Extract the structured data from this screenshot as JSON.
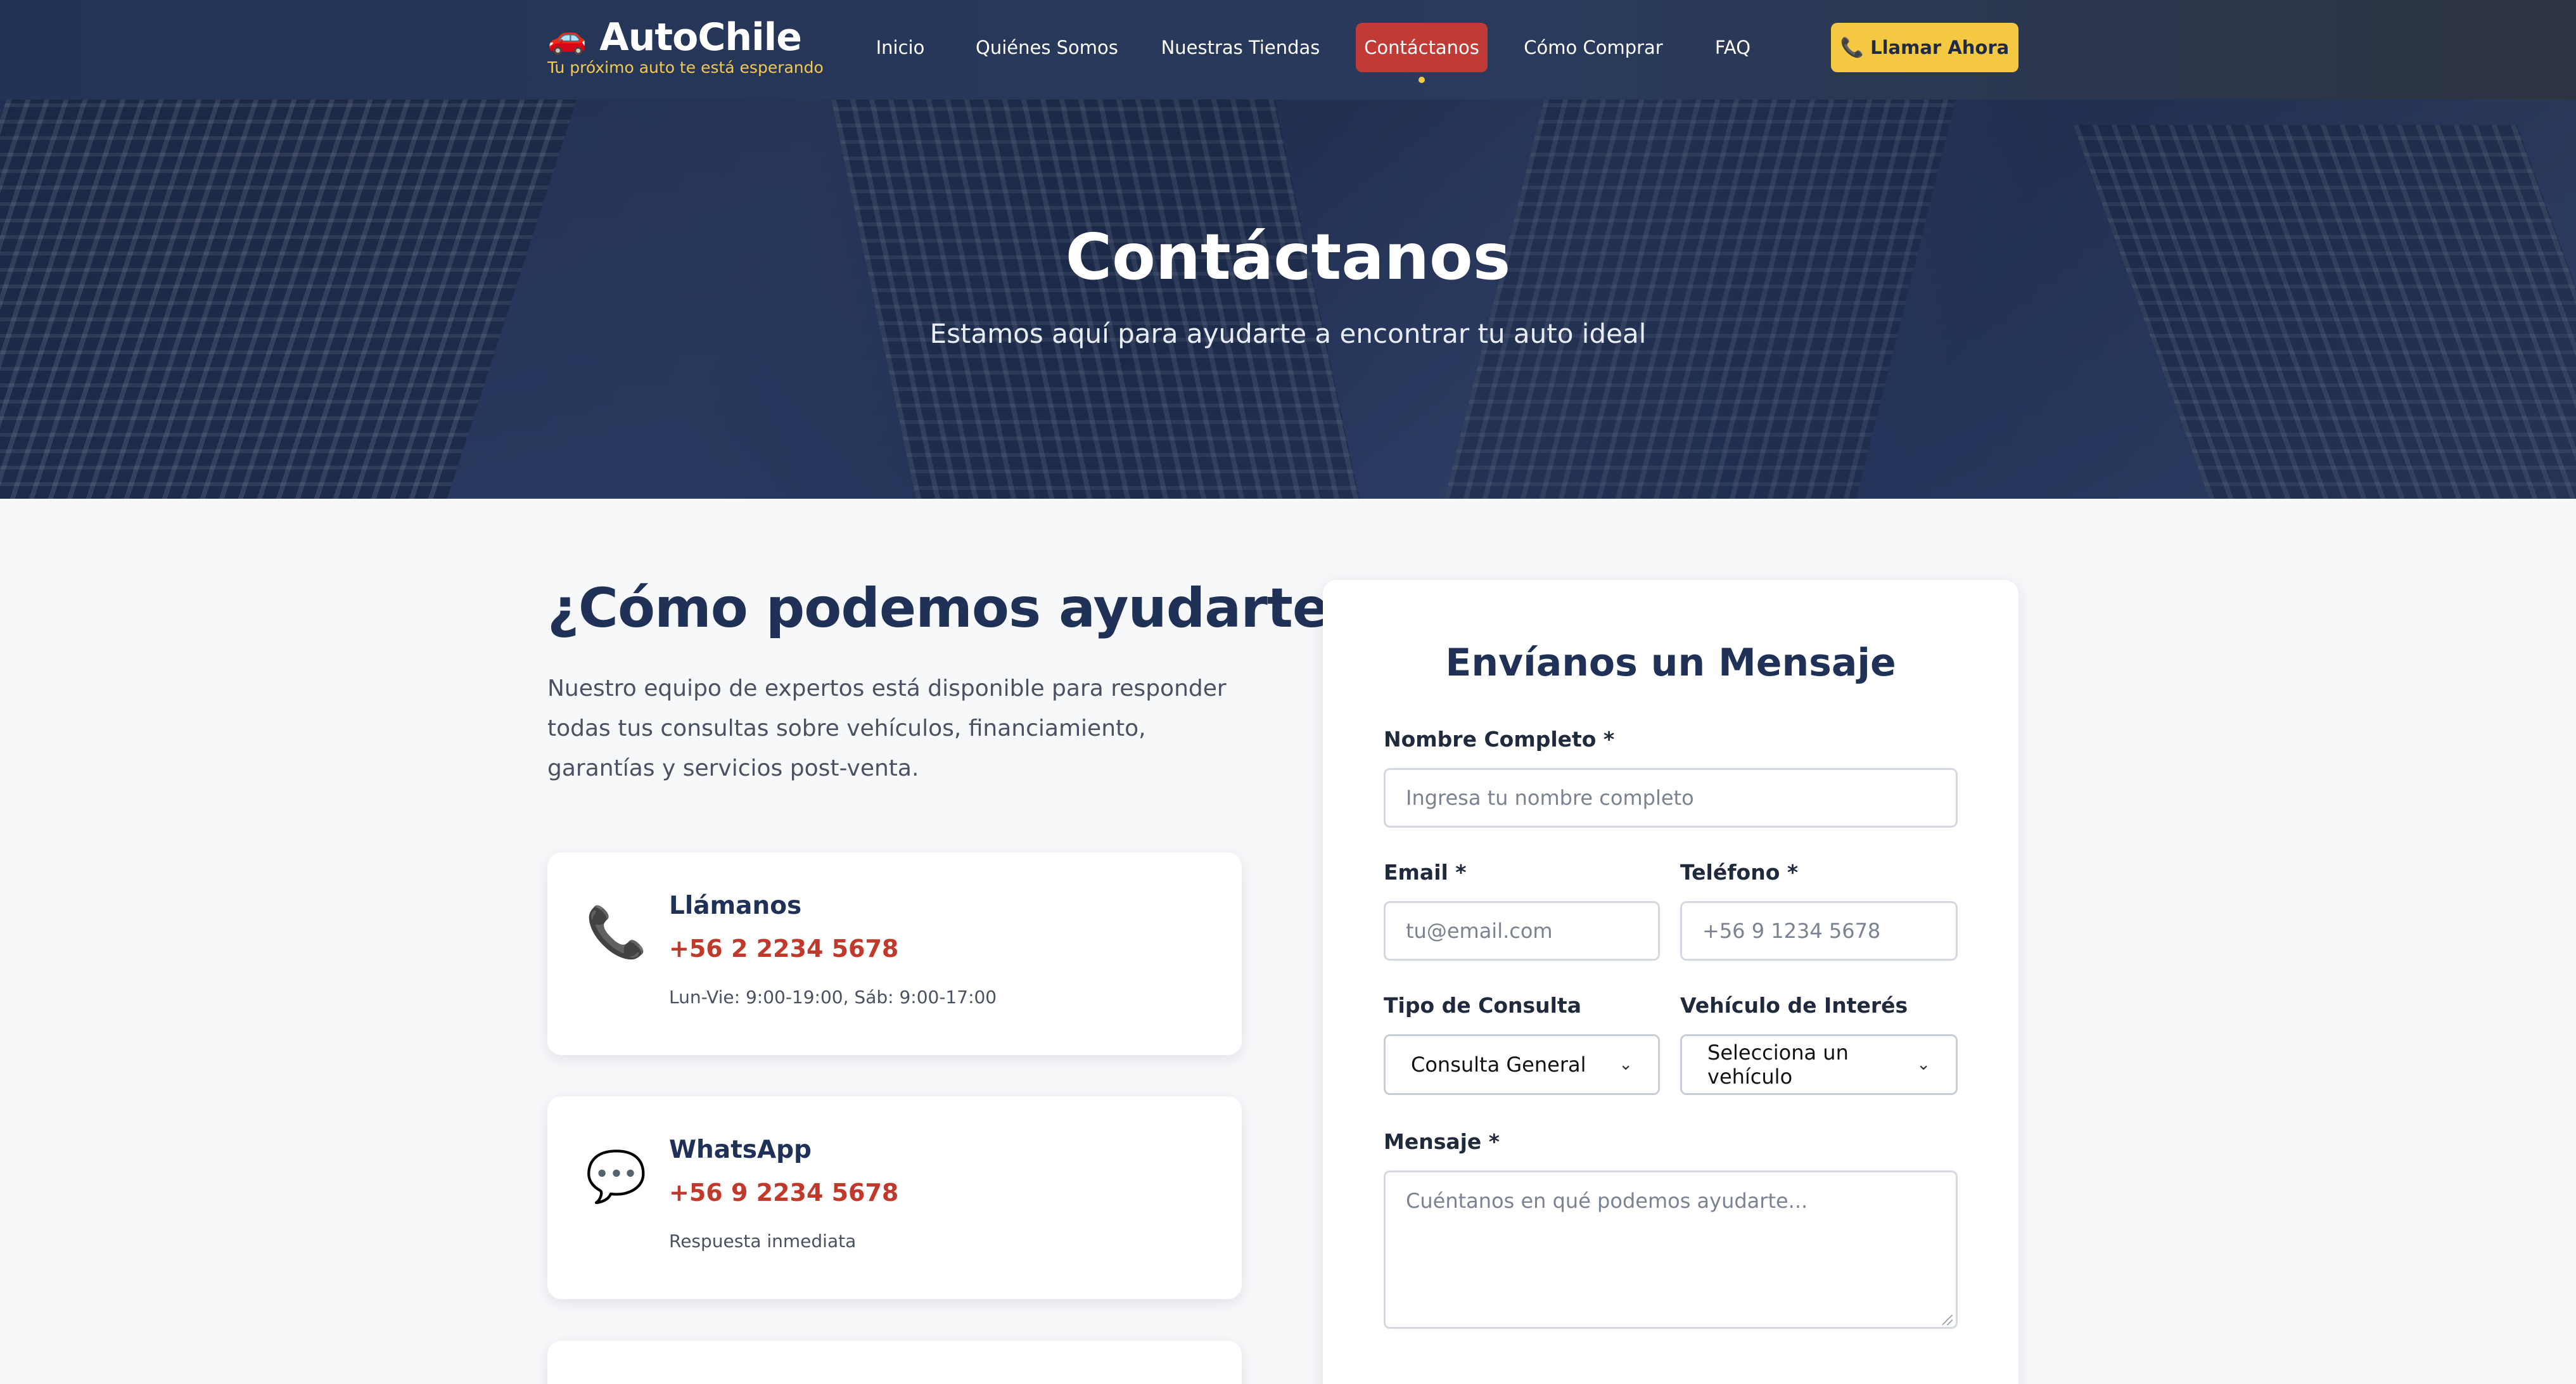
{
  "brand": {
    "icon": "car-icon",
    "name": "AutoChile",
    "tagline": "Tu próximo auto te está esperando"
  },
  "nav": {
    "items": [
      {
        "label": "Inicio"
      },
      {
        "label": "Quiénes Somos"
      },
      {
        "label": "Nuestras Tiendas"
      },
      {
        "label": "Contáctanos",
        "active": true
      },
      {
        "label": "Cómo Comprar"
      },
      {
        "label": "FAQ"
      }
    ],
    "call_label": "Llamar Ahora",
    "call_icon": "phone-icon"
  },
  "hero": {
    "title": "Contáctanos",
    "subtitle": "Estamos aquí para ayudarte a encontrar tu auto ideal"
  },
  "help": {
    "title": "¿Cómo podemos ayudarte?",
    "description": "Nuestro equipo de expertos está disponible para responder todas tus consultas sobre vehículos, financiamiento, garantías y servicios post-venta."
  },
  "contact_cards": [
    {
      "icon": "phone-icon",
      "title": "Llámanos",
      "value": "+56 2 2234 5678",
      "note": "Lun-Vie: 9:00-19:00, Sáb: 9:00-17:00"
    },
    {
      "icon": "chat-bubble-icon",
      "title": "WhatsApp",
      "value": "+56 9 2234 5678",
      "note": "Respuesta inmediata"
    }
  ],
  "form": {
    "title": "Envíanos un Mensaje",
    "name_label": "Nombre Completo *",
    "name_placeholder": "Ingresa tu nombre completo",
    "email_label": "Email *",
    "email_placeholder": "tu@email.com",
    "phone_label": "Teléfono *",
    "phone_placeholder": "+56 9 1234 5678",
    "type_label": "Tipo de Consulta",
    "type_value": "Consulta General",
    "vehicle_label": "Vehículo de Interés",
    "vehicle_value": "Selecciona un vehículo",
    "message_label": "Mensaje *",
    "message_placeholder": "Cuéntanos en qué podemos ayudarte..."
  },
  "colors": {
    "navy": "#1f3156",
    "accent_red": "#c0392b",
    "accent_yellow": "#f5c842"
  }
}
